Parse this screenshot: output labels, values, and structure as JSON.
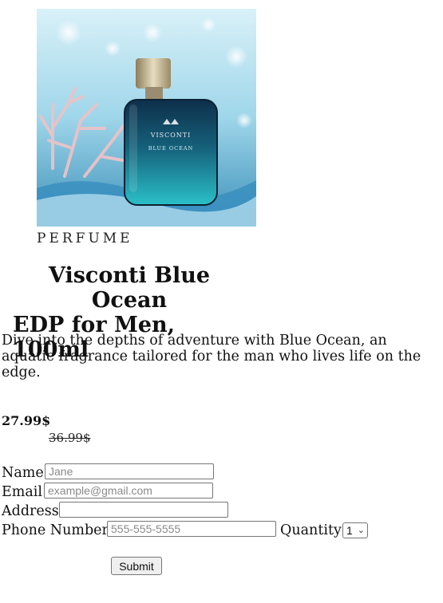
{
  "product": {
    "image_alt": "Visconti Blue Ocean bottle",
    "bottle_brand": "VISCONTI",
    "bottle_name": "BLUE OCEAN",
    "category": "PERFUME",
    "title_line1": "Visconti Blue Ocean",
    "title_line2": "EDP for Men, 100ml",
    "description_line1": "Dive into the depths of adventure with Blue Ocean, an",
    "description_line2": "aquatic fragrance tailored for the man who lives life on the edge.",
    "price": "27.99$",
    "original_price": "36.99$"
  },
  "form": {
    "name_label": "Name",
    "name_placeholder": "Jane",
    "email_label": "Email",
    "email_placeholder": "example@gmail.com",
    "address_label": "Address",
    "address_placeholder": "",
    "phone_label": "Phone Number",
    "phone_placeholder": "555-555-5555",
    "quantity_label": "Quantity",
    "quantity_value": "1",
    "submit_label": "Submit"
  },
  "colors": {
    "water_light": "#bfe6f2",
    "water_dark": "#2f7fa8",
    "bottle_teal": "#1b8a9a",
    "cap_gold": "#cbb994"
  }
}
